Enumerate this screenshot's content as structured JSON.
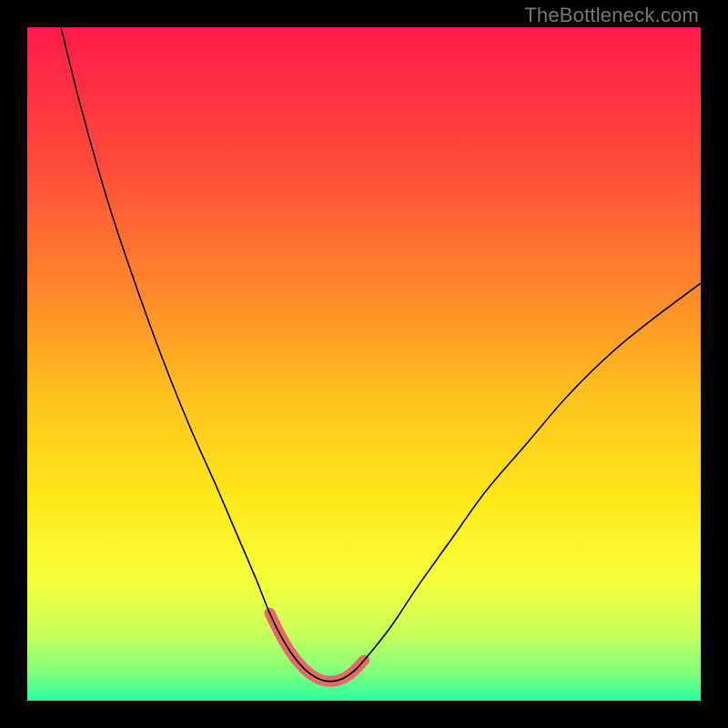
{
  "watermark": "TheBottleneck.com",
  "chart_data": {
    "type": "line",
    "title": "",
    "xlabel": "",
    "ylabel": "",
    "xlim": [
      0,
      100
    ],
    "ylim": [
      0,
      100
    ],
    "grid": false,
    "legend": false,
    "annotations": [],
    "background_gradient": {
      "stops": [
        {
          "pos": 0.0,
          "color": "#ff1a4b"
        },
        {
          "pos": 0.2,
          "color": "#ff4a3a"
        },
        {
          "pos": 0.4,
          "color": "#ff8a2a"
        },
        {
          "pos": 0.55,
          "color": "#ffc21e"
        },
        {
          "pos": 0.7,
          "color": "#ffe81a"
        },
        {
          "pos": 0.82,
          "color": "#f7ff3a"
        },
        {
          "pos": 0.9,
          "color": "#c8ff5a"
        },
        {
          "pos": 0.96,
          "color": "#7dff7d"
        },
        {
          "pos": 1.0,
          "color": "#2bffa0"
        }
      ]
    },
    "series": [
      {
        "name": "bottleneck-curve",
        "color": "#000000",
        "width": 1.6,
        "x": [
          5,
          8,
          12,
          16,
          20,
          24,
          28,
          31,
          34,
          36,
          38,
          40,
          42,
          44,
          46,
          48,
          50,
          54,
          58,
          63,
          68,
          74,
          80,
          86,
          92,
          100
        ],
        "y": [
          100,
          88,
          74,
          62,
          51,
          41,
          32,
          25,
          18,
          13,
          9,
          6,
          4,
          3,
          3,
          4,
          6,
          11,
          17,
          24,
          31,
          38,
          45,
          51,
          56,
          62
        ]
      },
      {
        "name": "trough-highlight",
        "color": "#e26a6a",
        "width": 12,
        "linecap": "round",
        "x": [
          36,
          38,
          40,
          42,
          44,
          46,
          48,
          50
        ],
        "y": [
          13,
          9,
          6,
          4,
          3,
          3,
          4,
          6
        ]
      }
    ]
  }
}
